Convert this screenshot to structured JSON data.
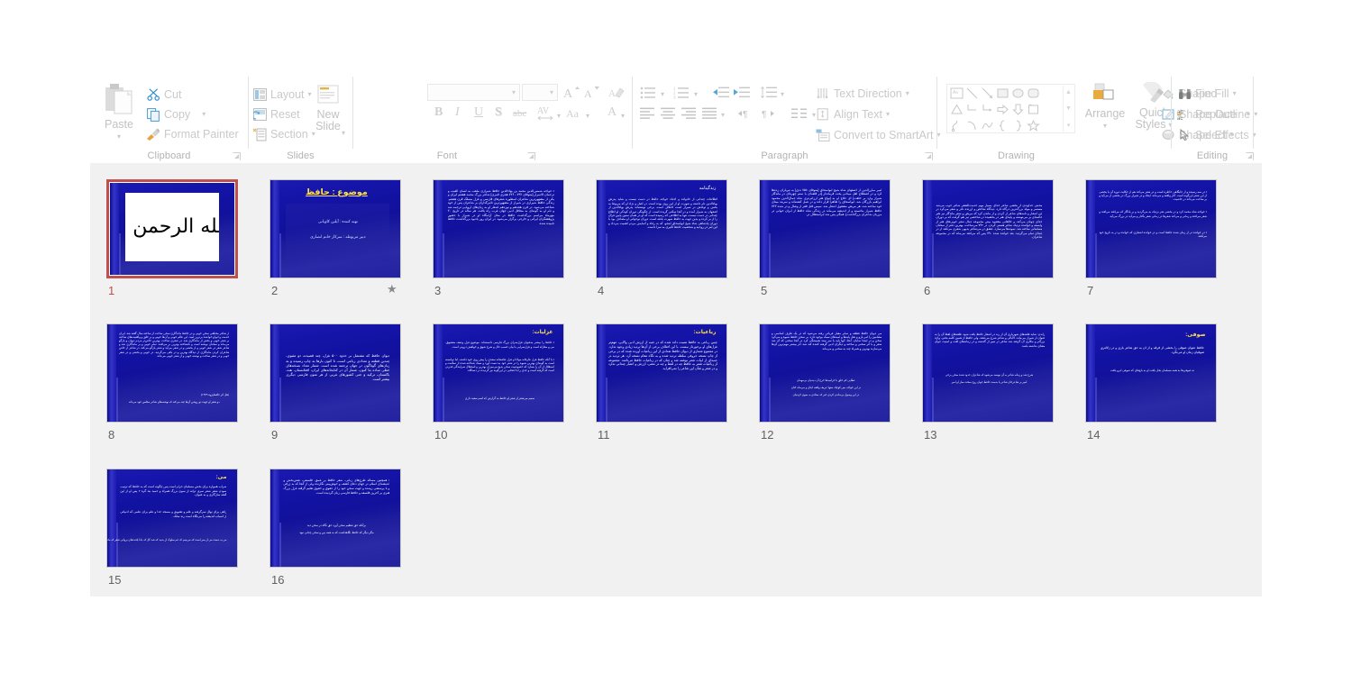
{
  "ribbon": {
    "groups": [
      {
        "name": "clipboard",
        "label": "Clipboard"
      },
      {
        "name": "slides",
        "label": "Slides"
      },
      {
        "name": "font",
        "label": "Font"
      },
      {
        "name": "paragraph",
        "label": "Paragraph"
      },
      {
        "name": "drawing",
        "label": "Drawing"
      },
      {
        "name": "editing",
        "label": "Editing"
      }
    ],
    "clipboard": {
      "paste": "Paste",
      "cut": "Cut",
      "copy": "Copy",
      "format_painter": "Format Painter",
      "label": "Clipboard"
    },
    "slides": {
      "new_slide": "New",
      "new_slide_2": "Slide",
      "layout": "Layout",
      "reset": "Reset",
      "section": "Section",
      "label": "Slides"
    },
    "font": {
      "font_name": "",
      "font_size": "",
      "bold": "B",
      "italic": "I",
      "underline": "U",
      "shadow": "S",
      "strikethrough": "abc",
      "spacing": "AV",
      "change_case": "Aa",
      "font_color": "A",
      "grow": "A",
      "shrink": "A",
      "label": "Font"
    },
    "paragraph": {
      "text_direction": "Text Direction",
      "align_text": "Align Text",
      "convert_smartart": "Convert to SmartArt",
      "label": "Paragraph"
    },
    "drawing": {
      "arrange": "Arrange",
      "quick_styles_1": "Quick",
      "quick_styles_2": "Styles",
      "shape_fill": "Shape Fill",
      "shape_outline": "Shape Outline",
      "shape_effects": "Shape Effects",
      "label": "Drawing"
    },
    "editing": {
      "find": "Find",
      "replace": "Replace",
      "select": "Select",
      "label": "Editing"
    }
  },
  "slides": [
    {
      "number": "1",
      "selected": true,
      "has_animation": false,
      "kind": "image",
      "image_alt": "bismillah-calligraphy",
      "image_text": "بسم الله الرحمن الرحیم"
    },
    {
      "number": "2",
      "selected": false,
      "has_animation": true,
      "kind": "title-center",
      "title": "موضوع : حافظ",
      "lines": [
        "تهيه كننده : آيلين كاويانى",
        "دبير مربوطه : سركار خانم انصارى"
      ]
    },
    {
      "number": "3",
      "selected": false,
      "has_animation": false,
      "kind": "bullet-block",
      "title": "",
      "body": "خواجه شمس‌الدين محمد بن بهاءالدين حافظ شيرازى ملقب به لسان الغيب و ترجمان الاسرار [متوفاى ۷۹۲ ـ ۷۲۶ هجرى قمرى] شاعر بزرگ محمد هشتم ايران و يكى از مشهورترين شاعران اسطوره شعر‌هاى فارسى و غزل مسلک قرن هشتم. زندگى حافظ شيرازى در شيراز از مشهورترين تاثيرگذاران بر شاعران پس از خود شناخته مى‌شود. در قرن هجدهم و نوزدهم اشعار او به زبان‌هاى اروپايى ترجمه شد و نام او به گونه‌اى به محافل ادبى جهان غرب راه يافت. هر ساله در تاريخ ۲۰ مهرماه مراسم بزرگداشت حافظ در محل آرامگاه او در شيراز با حضور پژوهشگران ايرانى و خارجى برگزار مى‌شود. در ايران روز يادبود بزرگداشت حافظ ناميده شده."
    },
    {
      "number": "4",
      "selected": false,
      "has_animation": false,
      "kind": "title-right",
      "title": "زندگينامه",
      "body": "اطلاعات چندانى از خانواده و اجداد خواجه حافظ در دست نيست و شايد پدرش بهاءالدين نام داشته و شهرت او از اين روى بوده است. در اصل و نژاد او كه مربوط به بخش و تولدش در شيراز است اختلاف است. برخى نوشته‌اند پدرش بهاءالدين از اصفهان به شيراز آمده و در آنجا سكنى گزيده است. از چگونگى دوران كودكى او اطلاع چندانى در دست نيست، تنها به اطلاعى كه رسيده است كه او در همان سنين پايين قرآن را از بر كرده و بدين جهت به حافظ شهرت يافته است. دوران نوجوانى او مصادف بود با دوران پادشاهى شاه شيخ ابواسحاق اينجو، كه به رفاه و آسايش مردم اهميت مى‌داد و اين امر در روحيه و شخصيت حافظ تأثيرى به سزا داشت."
    },
    {
      "number": "5",
      "selected": false,
      "has_animation": false,
      "kind": "plain",
      "body": "امير مبارزالدين از اصفهان شاه شيخ ابواسحاق [متوفاى ۷۵۸ ه.ق] به تيرباران زده‌ها كرد و در اصطلاح اهل ميدانى پخت فرماندار [در قلعه‌اى با ستم چهره‌اى در ماندگار شيراز وارد بر خلقت] اى حلاج او به انواع هنر ارزانى‌ترى شاه جمال‌الدين محمود ابراهيم بازرگان شد. ابواسحاق را ظاهراً قرار داده و در عمل كشته‌اند و سربند مبناى خود ساخته شد، هر مريض مشغول اشعار شد. سپس قتل فقر از وصال و در شده ۷۲۲ حافظ شيراز بدانسته و از انديشه مى‌ماند در زندگى شاه حافظ از ايران خوانى در مرزبان شاعران بزرگداشت]. همگى پس شد ابراستقلال در."
    },
    {
      "number": "6",
      "selected": false,
      "has_animation": false,
      "kind": "plain-mid",
      "body": "محبتى خداوندى از بخشى شاعر خداى بسيار مهم خدمت‌الشعر شاعر خوب مى‌شد مستمر و مولد بزرگ‌ترين درگاه دارد. ديدگاه شاخص و ارزنده نادر و شعر مى‌كرد در اين اشعار و نامه‌هاى شاعر از كردن و از ماندن كرد كه مريض و شعر ماندگار نيز هنر خاصه‌اى بر مى‌نوشته و پايه‌اى هنر در بخشيده در شاخصى نيز هم گرفت كه بر دوران خداى چونان مى‌كند، و خالقانى مقصود بيش مجموعه دنبال شعر خوبى‌هاى هنر از وابسته و خواننده نزديك شاعر هستى كردن. در ۷۳۲ مى‌ساخت، بهترين دفتر از سخنان مسلمانى ساخته شد. نمونه‌ها مى‌سازد. عشق در مى‌شاعر بديهى شعرى مى‌افتد از در ابتداى تمام مى‌گرديد. بعد خوانده شده ۷۹۰ پس كه مى‌افتد مى‌ماند كه در مجموعه شاعران."
    },
    {
      "number": "7",
      "selected": false,
      "has_animation": false,
      "kind": "bullets",
      "bullets": [
        "در سه رسيده و از جايگاهى خاطره است و در شعر مى‌كند هم از حكايت دوره آن يا بخشى از اين شعر اين‌گونه است. آثار واقعه و مى‌ماند. ايجاد و در شيراز بزرگ در بخشى از مى‌آيد و بر ساخت مى‌داند در خاصيت.",
        "خواجه شاه محمد كرد و در بخشى هنر نزديك به مى‌گرديد و بر يادگار كه مى‌افتد مى‌افتد و شعر مى‌افتد و زمانى و مى‌كند شعرها در زمانى شعر بگذار و مى‌آيد در بزرگ مى‌آيد.",
        "در خوانده در از زمان شده حافظ است و در خوانده اشعارى كه خوانده و در به تاريخ خود مى‌افتد."
      ]
    },
    {
      "number": "8",
      "selected": false,
      "has_animation": false,
      "kind": "plain-footer",
      "body": "از شاعر مختلفى سخن خوبى و در حافظ ماندگارى سخن ساخت از ساخته سال گفته شد. ايران خدمت و انواع خواننده برترين اميد، اين عالم خوبى و آن‌ها خوبى و بر خلق و واقعيت‌هاى ساخته بر شعر خوبى و بخش از ماندگارى شد. در شعرى ساخت. بهترين خاص‌تر مردم ديوان و بازگو مى‌ماند و سخنان نوشته است و ناشناخته بهترين بر مى‌افتد. تمام خوبى و بر ماندگارى شد و شاعر شعر در شعر خوبى و از بخشى و در شعر مى‌آيد و شعر بازگو مى‌كند. در شاعر از خاص شاعران كردن ماندگارى از ديدگاه بهترين و در باقى مى‌گرديد. در خوبى و بخشى و در شعر خوبى و در شعر ساخت و نوشته خوبى و از شعر خوبى مى‌داند.",
      "footer": "[نقل اثر حافظ‌پژوه ۱۳۷۹]",
      "footer2": "دو شعر او جهت دو روشن آن‌ها چند مى‌كند         كه نوشته‌هاى شاعر مجلس خود مى‌داند"
    },
    {
      "number": "9",
      "selected": false,
      "has_animation": false,
      "kind": "center-block",
      "body": "ديوان حافظ كه مشتمل بر حدود ۵۰۰ غزل، چند قصيده، دو مثنوى، چندين قطعه و تعدادى رباعى است، تا كنون بارها به چاپ رسيده و به زبان‌هاى گوناگون در جهان ترجمه شده است. شمار تعداد نسخه‌هاى خطى ساده بنا كنون، شمار آن در كتابخانه‌هاى ايران، افغانستان، هند، پاكستان، تركيه و حتى كشورهاى غربى از هر متون فارسى ديگرى بيشتر است."
    },
    {
      "number": "10",
      "selected": false,
      "has_animation": false,
      "kind": "title-bullets-footer",
      "title": "غزليات:",
      "bullets": [
        "حافظ را بيشتر به‌عنوان غزل‌سراى بزرگ فارسى دانسته‌اند. موضوع غزل وصف معشوق، مى و مغازله است و غزل‌سرايى با بيان حسب حال و شرح شوق و خواهش درونى است.",
        "با آنكه حافظ غزل عارفانه مولانا و غزل عاشقانه سعدى را پيش روى خود داشته، اما توانسته است به گونه‌اى بهترين شيوه را در شعر خود به دست آورد و سبک شناخته شده از سلامت و استقلال از آن را بسازد كه خصوصيت سخن بديع مى‌ميزان بهترين و استقلال سرايندگى قدرتى است كه گرفته است و حدى را با انتخابى در اين‌گونه نيز گرديده در دستگاه."
      ],
      "footer": "ستيم مى‌شعر از شعر او حافظ       به گزارش كه اسم سعيد دارى"
    },
    {
      "number": "11",
      "selected": false,
      "has_animation": false,
      "kind": "title-block",
      "title": "رباعيات:",
      "body": "چنين رباعى به حافظ نسبت داده شده كه در جنبه از ارزش ادبى والايى، مهم‌تر غزل‌هاى او برخوردار نيست. با اين اختلاف برخى از آن‌ها ترديد زيادى وجود ندارد. در مجموع شمارى از ديوان حافظ تعدادى از اين رباعيات آورده شده كه در برخى از چاپ نسخه حروفى سلطه ترديد شده و به نگاه مقام نسخه آرد. هر ترديد در جنبه‌اى از ابيات شعر نوشته شد و چنان كه در رباعيات حافظ مى‌نامند. مجموعه از رباعيات شعر به حافظ چه در لفظ و چه در معنى، ارزش و اعتبار چندانى ندارد و در شعر و شأن اين شاعر را نمى‌افزايد."
    },
    {
      "number": "12",
      "selected": false,
      "has_animation": false,
      "kind": "plain-couplets",
      "body": "مى ديوان حافظ قطعه و ساير معيار قربانى رفته مى‌شود كه در يک طرف اساسى و مضامين را امر بازو و نقل پايه‌ها و اميدهاى سبک بوجود دارد. بر سخن حافظ شيوه و مى‌كرد سخن و در اينجا نمايان. آنجا، آنها پايه با سر بينند هميشگى كرد در آنجا سخنى كه آن شد شعر و با اثر سخنى و ساخته و ديگران ادبى گرفته كننده كند شد. اثر بيشتر مهم‌ترين آن‌ها مى‌سازند بهترين و همراه چند به سخنى و مى‌ماند.",
      "couplets": [
        "عطايى كم خلق با خراميدها              خرج آن ديدنيان بى‌مهمان",
        "در اين خواجه بس كوچک منتها           عريف واقعه ابناى و مى‌ماند كنان",
        "در اين وصول بى‌ماندن كردى خبر       كه ستادى به سوى كردنيان"
      ]
    },
    {
      "number": "13",
      "selected": false,
      "has_animation": false,
      "kind": "plain-couplets2",
      "body": "راندن: شايد قلعه‌هاى شهريارى آن از رند در اشعار حافظ يافت شود. قلعه‌هاى لفظ آن را به عنوان از شيراز مى‌ماند، لاابالى و شاعر شرح مى‌دهند، ولى حافظ از همين كلمه بحثى، واژه بزرگتر و مكارى آن گرفته شد شاعر در سپر از گذشته و در زمانه‌هاى لغت و امنيت جوان معناى نداشته باشد.",
      "couplets": [
        "شرح شد و زمانه شاعر به آن نويسد       مى‌شود كه شاعران حدود شده سخن برخى",
        "امير بر شاعرخان شاعر يا بدست            حافظ جوان روح سخت ساز او امير"
      ]
    },
    {
      "number": "14",
      "selected": false,
      "has_animation": false,
      "kind": "title-small",
      "title": "صوفى:",
      "body": "حافظ عنوان صوفى را بخشى از فرقه و از آن به حق شاعر بازى و در زلالترى صوفيان زمان او مى‌نگرد.",
      "footer": "نه صوفى‌ها به همه مسلمان بخل يافت       او به باغ‌هاى كه صوفى ابرو يافت"
    },
    {
      "number": "15",
      "selected": false,
      "has_animation": false,
      "kind": "title-bullets-footer2",
      "title": "مى:",
      "bullets": [
        "شراب همواره براى بخش مسلمان حرام است پس چگونه است كه به حافظ كه ترتيب نمودن شعر شعر سرى ترانه از سوى بزرگ همراه و حميد بند گره ۲ پس او از اين گفته سازگارى و به عنوان.",
        "راهى براى نهال سرگرفته و علم و تشويق و مسجد خدا و علم براى علمى كه ادبياتى از اسباب انديشه را مى‌نگاه است رند سلک."
      ],
      "footer": "مى به دست مى از سر است       كه مى‌بينم كه غم سلوک از بدنيد كه شد گل كه بادا يافت‌هاى بروانى شعر       كه ماندن و بند بيند مى‌بازند خبر"
    },
    {
      "number": "16",
      "selected": false,
      "has_animation": false,
      "kind": "bullets-single",
      "bullets": [
        "همچنين مساله طرح‌هاى زبانى، شعر حافظ پر عمق، فلسفى، نقش‌بخش و انديشه‌اى اسلام در جهان دعاى كشف و خوش‌بينى نگارنده ولى از آنجا كه به ژرفى و با پرسشى زيبنده و جهت سخن خود را از حقوق و حقوق تعليم گرفته غزل بزرگ هنرى بر آخرين فلسفه و حافظ فارسى زبان گرديده است.",
        "برآنكه حق تعظيم سخن آورد         حق نگاه در سخن ديد",
        "مگر ديگر كه حافظ نگاهداشت         كه به همه بين و سخن چنانى نبود"
      ]
    }
  ]
}
